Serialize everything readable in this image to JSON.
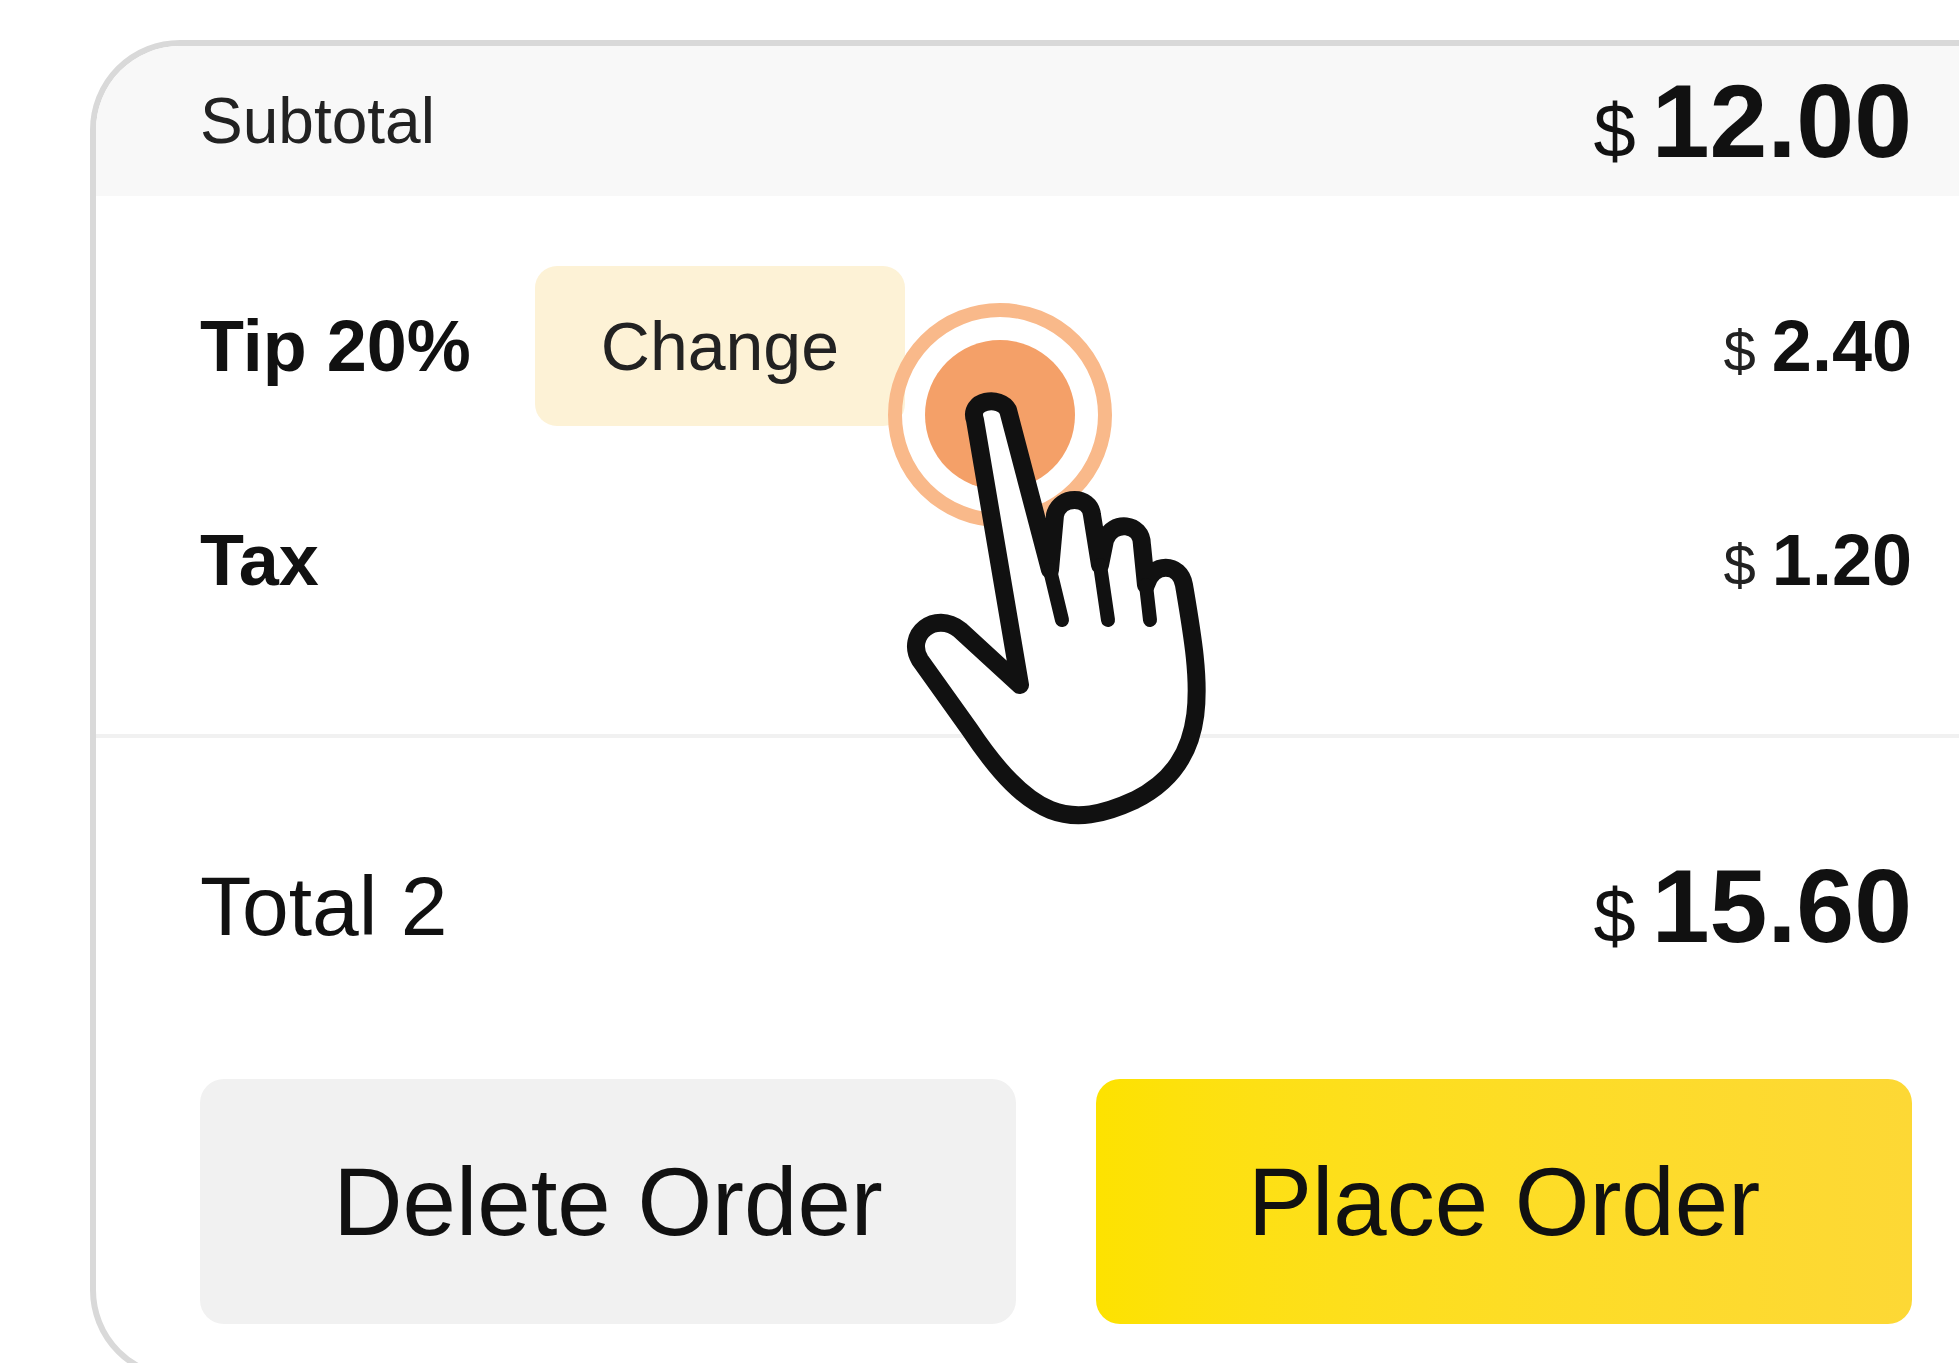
{
  "subtotal": {
    "label": "Subtotal",
    "currency": "$",
    "amount": "12.00"
  },
  "tip": {
    "label": "Tip 20%",
    "action": "Change",
    "currency": "$",
    "amount": "2.40"
  },
  "tax": {
    "label": "Tax",
    "currency": "$",
    "amount": "1.20"
  },
  "total": {
    "label": "Total 2",
    "currency": "$",
    "amount": "15.60"
  },
  "buttons": [
    {
      "label": "Delete Order",
      "kind": "secondary"
    },
    {
      "label": "Place Order",
      "kind": "primary"
    }
  ]
}
